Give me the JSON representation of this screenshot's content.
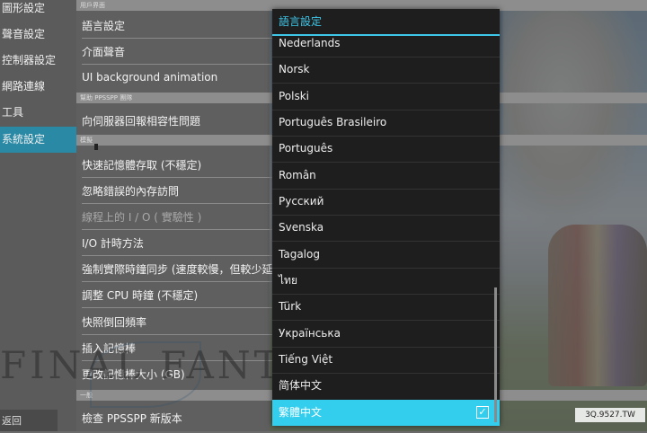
{
  "nav": {
    "items": [
      {
        "label": "圖形設定",
        "active": false
      },
      {
        "label": "聲音設定",
        "active": false
      },
      {
        "label": "控制器設定",
        "active": false
      },
      {
        "label": "網路連線",
        "active": false
      },
      {
        "label": "工具",
        "active": false
      },
      {
        "label": "系統設定",
        "active": true
      }
    ],
    "back_label": "返回"
  },
  "settings": {
    "header_top": "用戶界面",
    "rows_group1": [
      "語言設定",
      "介面聲音",
      "UI background animation"
    ],
    "header_ppsspp": "幫助 PPSSPP 團隊",
    "rows_group2": [
      "向伺服器回報相容性問題"
    ],
    "header_emu": "模擬",
    "rows_group3": [
      {
        "label": "快速記憶體存取 (不穩定)",
        "dim": false
      },
      {
        "label": "忽略錯誤的內存訪問",
        "dim": false
      },
      {
        "label": "線程上的 I / O ( 實驗性 )",
        "dim": true
      },
      {
        "label": "I/O 計時方法",
        "dim": false
      },
      {
        "label": "強制實際時鐘同步 (速度較慢，但較少延遲)",
        "dim": false
      },
      {
        "label": "調整 CPU 時鐘 (不穩定)",
        "dim": false
      },
      {
        "label": "快照倒回頻率",
        "dim": false
      },
      {
        "label": "插入記憶棒",
        "dim": false
      },
      {
        "label": "更改記憶棒大小 (GB)",
        "dim": false
      }
    ],
    "header_general": "一般",
    "rows_group4": [
      "檢查 PPSSPP 新版本"
    ]
  },
  "logo_text": "FINAL FANTASY",
  "dialog": {
    "title": "語言設定",
    "languages": [
      "Nederlands",
      "Norsk",
      "Polski",
      "Português Brasileiro",
      "Português",
      "Român",
      "Русский",
      "Svenska",
      "Tagalog",
      "ไทย",
      "Türk",
      "Українська",
      "Tiếng Việt",
      "简体中文",
      "繁體中文"
    ],
    "selected": "繁體中文",
    "check_glyph": "✓"
  },
  "watermark": "3Q.9527.TW",
  "colors": {
    "accent": "#33cdee",
    "nav_active": "#2a8aa6"
  }
}
